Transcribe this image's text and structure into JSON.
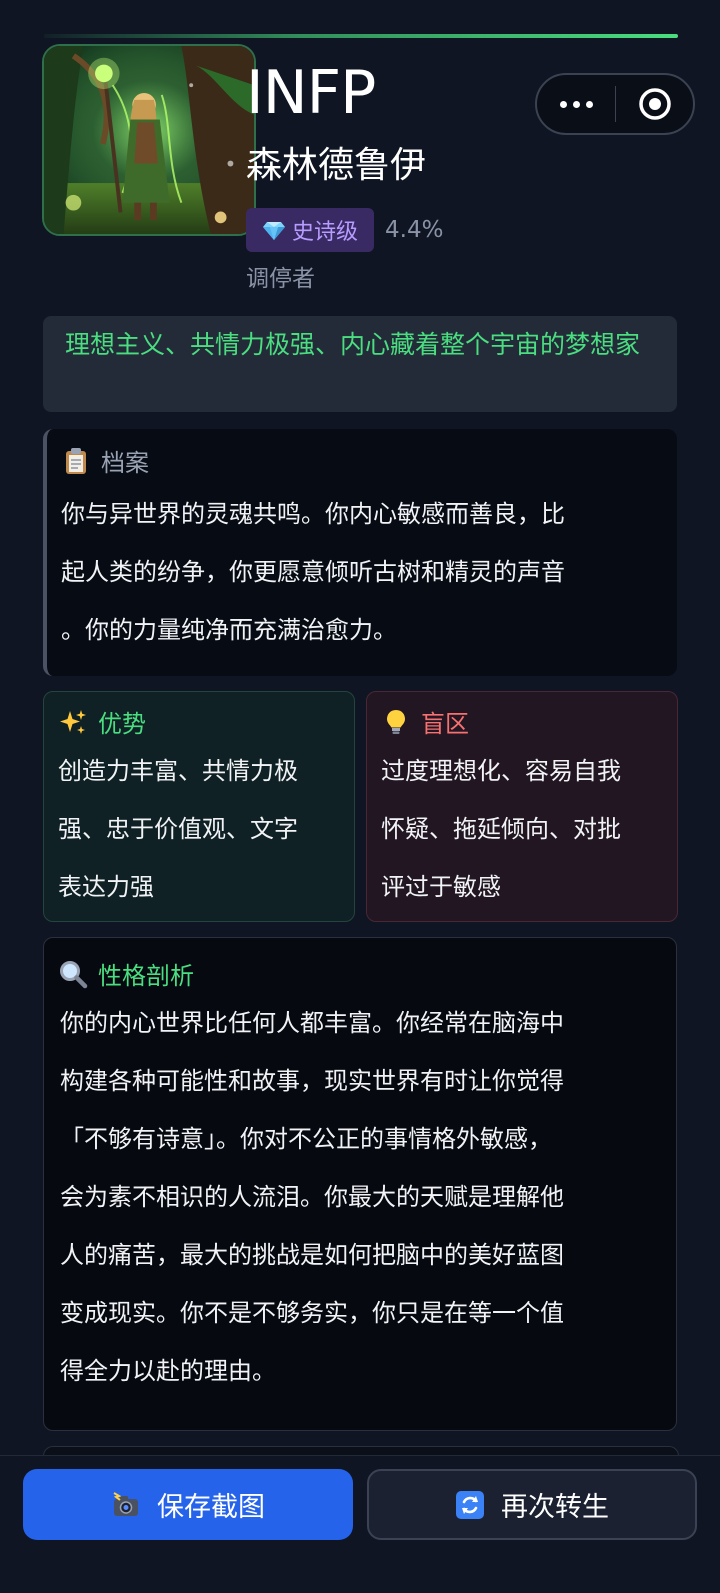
{
  "header": {
    "type_code": "INFP",
    "type_name": "森林德鲁伊",
    "rarity_label": "史诗级",
    "rarity_percent": "4.4%",
    "role_name": "调停者",
    "tagline": "理想主义、共情力极强、内心藏着整个宇宙的梦想家"
  },
  "capsule": {
    "more_icon": "more-dots-icon",
    "close_icon": "target-close-icon"
  },
  "profile": {
    "icon": "clipboard-icon",
    "title": "档案",
    "lines": [
      "你与异世界的灵魂共鸣。你内心敏感而善良，比",
      "起人类的纷争，你更愿意倾听古树和精灵的声音",
      "。你的力量纯净而充满治愈力。"
    ]
  },
  "strengths": {
    "icon": "sparkles-icon",
    "title": "优势",
    "lines": [
      "创造力丰富、共情力极",
      "强、忠于价值观、文字",
      "表达力强"
    ]
  },
  "blindspots": {
    "icon": "lightbulb-icon",
    "title": "盲区",
    "lines": [
      "过度理想化、容易自我",
      "怀疑、拖延倾向、对批",
      "评过于敏感"
    ]
  },
  "analysis": {
    "icon": "magnifier-icon",
    "title": "性格剖析",
    "lines": [
      "你的内心世界比任何人都丰富。你经常在脑海中",
      "构建各种可能性和故事，现实世界有时让你觉得",
      "「不够有诗意」。你对不公正的事情格外敏感，",
      "会为素不相识的人流泪。你最大的天赋是理解他",
      "人的痛苦，最大的挑战是如何把脑中的美好蓝图",
      "变成现实。你不是不够务实，你只是在等一个值",
      "得全力以赴的理由。"
    ]
  },
  "actions": {
    "save_label": "保存截图",
    "rebirth_label": "再次转生"
  },
  "colors": {
    "accent_green": "#4ade80",
    "epic_purple": "#b79cff",
    "blind_red": "#f87171",
    "primary_blue": "#2563eb"
  }
}
